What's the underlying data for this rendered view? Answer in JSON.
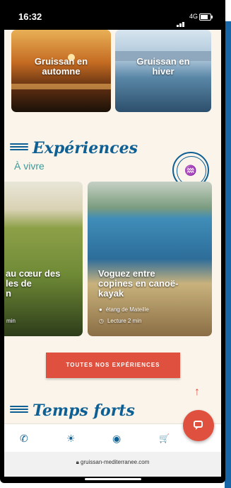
{
  "status_bar": {
    "time": "16:32",
    "network": "4G"
  },
  "cards_top": [
    {
      "label_line1": "Gruissan en",
      "label_line2": "automne"
    },
    {
      "label_line1": "Gruissan en",
      "label_line2": "hiver"
    }
  ],
  "experiences": {
    "heading": "Expériences",
    "subheading": "À vivre",
    "stamp_glyph": "♒",
    "cards": [
      {
        "title_line1": "au cœur des",
        "title_line2": "les de",
        "title_line3": "n",
        "meta_time": "min"
      },
      {
        "title_line1": "Voguez entre",
        "title_line2": "copines en canoë-",
        "title_line3": "kayak",
        "meta_location": "étang de Mateille",
        "meta_time": "Lecture 2 min"
      }
    ],
    "cta_label": "TOUTES NOS EXPÉRIENCES"
  },
  "temps_forts": {
    "heading": "Temps forts"
  },
  "scroll_top_glyph": "↑",
  "bottom_nav": [
    {
      "icon": "phone-icon",
      "glyph": "✆"
    },
    {
      "icon": "sun-icon",
      "glyph": "☀"
    },
    {
      "icon": "webcam-icon",
      "glyph": "◉"
    },
    {
      "icon": "cart-icon",
      "glyph": "🛒"
    }
  ],
  "url_bar": {
    "url": "gruissan-mediterranee.com"
  },
  "colors": {
    "accent": "#e0503f",
    "brand_blue": "#0e5f93",
    "teal": "#3a9a9a",
    "background": "#faf4ea"
  }
}
